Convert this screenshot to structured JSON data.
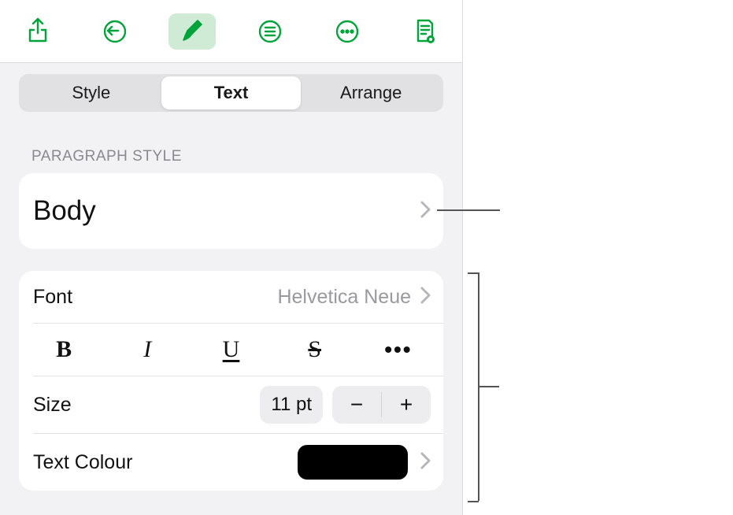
{
  "toolbar": {
    "share_icon": "share-icon",
    "undo_icon": "undo-icon",
    "format_icon": "paintbrush-icon",
    "list_icon": "list-icon",
    "more_icon": "more-icon",
    "doc_icon": "document-options-icon"
  },
  "tabs": {
    "style": "Style",
    "text": "Text",
    "arrange": "Arrange",
    "active": "text"
  },
  "paragraph_style": {
    "header": "Paragraph Style",
    "value": "Body"
  },
  "font": {
    "label": "Font",
    "value": "Helvetica Neue"
  },
  "style_buttons": {
    "bold": "B",
    "italic": "I",
    "underline": "U",
    "strike": "S",
    "more": "•••"
  },
  "size": {
    "label": "Size",
    "value": "11 pt",
    "minus": "−",
    "plus": "+"
  },
  "colour": {
    "label": "Text Colour",
    "value": "#000000"
  }
}
